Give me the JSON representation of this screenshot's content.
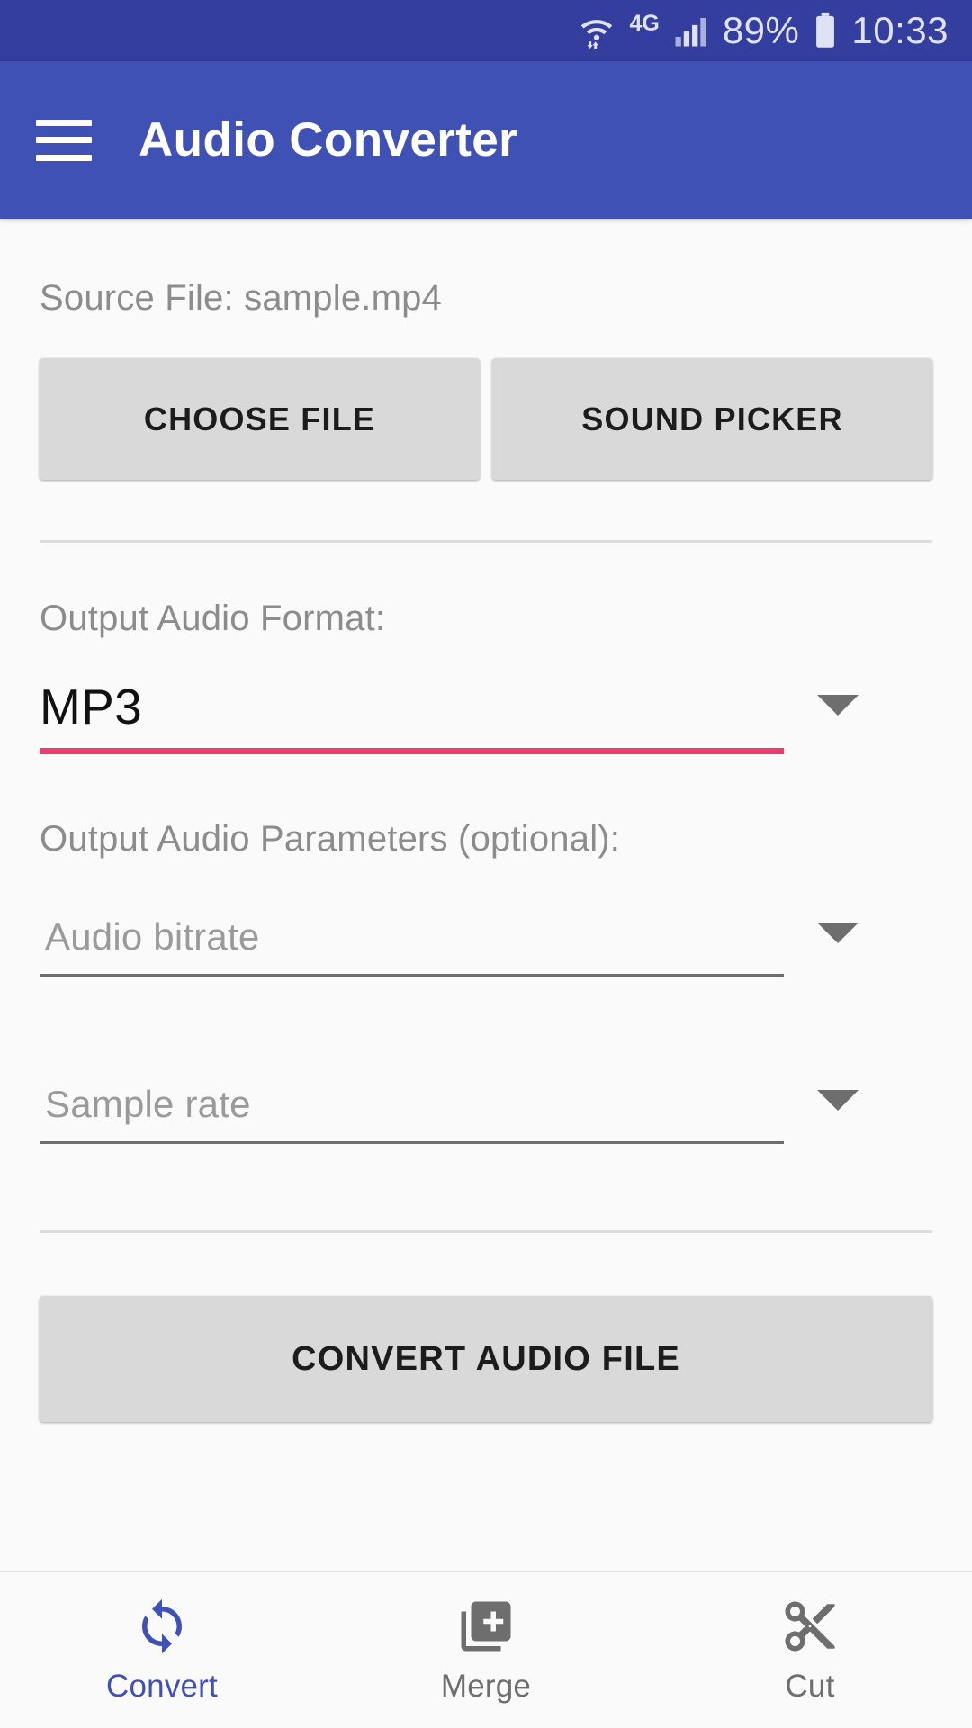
{
  "status_bar": {
    "wifi_icon": "wifi-data-icon",
    "network_type": "4G",
    "signal_icon": "signal-bars-icon",
    "battery_percent": "89%",
    "battery_icon": "battery-icon",
    "time": "10:33"
  },
  "app_bar": {
    "menu_icon": "hamburger-menu-icon",
    "title": "Audio Converter"
  },
  "main": {
    "source_file_label": "Source File: sample.mp4",
    "choose_file_label": "CHOOSE FILE",
    "sound_picker_label": "SOUND PICKER",
    "output_format_label": "Output Audio Format:",
    "output_format_value": "MP3",
    "output_params_label": "Output Audio Parameters (optional):",
    "audio_bitrate_placeholder": "Audio bitrate",
    "sample_rate_placeholder": "Sample rate",
    "convert_button_label": "CONVERT AUDIO FILE",
    "dropdown_icon": "chevron-down-icon"
  },
  "bottom_nav": {
    "items": [
      {
        "label": "Convert",
        "icon": "sync-refresh-icon",
        "active": true
      },
      {
        "label": "Merge",
        "icon": "library-add-icon",
        "active": false
      },
      {
        "label": "Cut",
        "icon": "scissors-icon",
        "active": false
      }
    ]
  },
  "colors": {
    "status_bar_bg": "#333e9e",
    "app_bar_bg": "#3f51b5",
    "accent_pink": "#ef3c72",
    "button_bg": "#d9d9d9",
    "page_bg": "#fafafa",
    "muted_text": "#8c8c8c",
    "nav_active": "#3f51b5",
    "nav_inactive": "#6e6e6e"
  }
}
